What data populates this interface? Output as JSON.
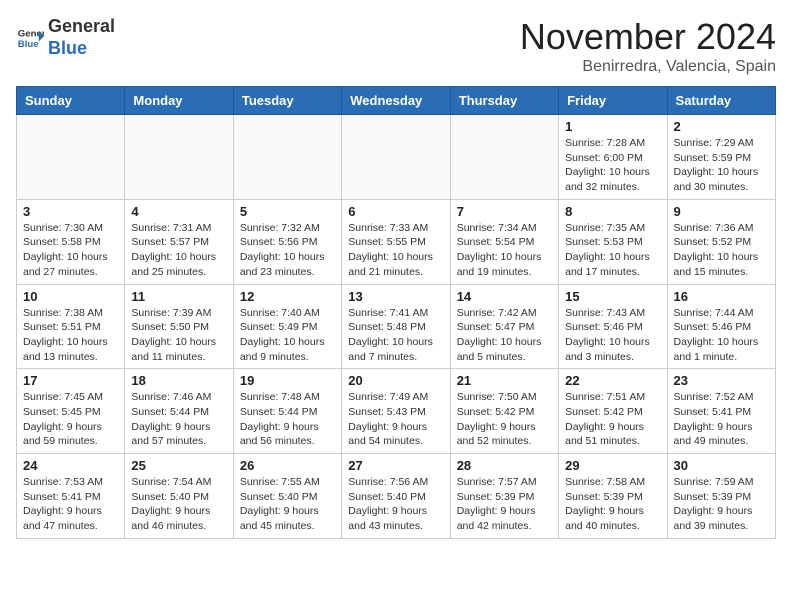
{
  "header": {
    "logo_general": "General",
    "logo_blue": "Blue",
    "month_year": "November 2024",
    "location": "Benirredra, Valencia, Spain"
  },
  "days_of_week": [
    "Sunday",
    "Monday",
    "Tuesday",
    "Wednesday",
    "Thursday",
    "Friday",
    "Saturday"
  ],
  "weeks": [
    [
      {
        "day": "",
        "info": ""
      },
      {
        "day": "",
        "info": ""
      },
      {
        "day": "",
        "info": ""
      },
      {
        "day": "",
        "info": ""
      },
      {
        "day": "",
        "info": ""
      },
      {
        "day": "1",
        "info": "Sunrise: 7:28 AM\nSunset: 6:00 PM\nDaylight: 10 hours\nand 32 minutes."
      },
      {
        "day": "2",
        "info": "Sunrise: 7:29 AM\nSunset: 5:59 PM\nDaylight: 10 hours\nand 30 minutes."
      }
    ],
    [
      {
        "day": "3",
        "info": "Sunrise: 7:30 AM\nSunset: 5:58 PM\nDaylight: 10 hours\nand 27 minutes."
      },
      {
        "day": "4",
        "info": "Sunrise: 7:31 AM\nSunset: 5:57 PM\nDaylight: 10 hours\nand 25 minutes."
      },
      {
        "day": "5",
        "info": "Sunrise: 7:32 AM\nSunset: 5:56 PM\nDaylight: 10 hours\nand 23 minutes."
      },
      {
        "day": "6",
        "info": "Sunrise: 7:33 AM\nSunset: 5:55 PM\nDaylight: 10 hours\nand 21 minutes."
      },
      {
        "day": "7",
        "info": "Sunrise: 7:34 AM\nSunset: 5:54 PM\nDaylight: 10 hours\nand 19 minutes."
      },
      {
        "day": "8",
        "info": "Sunrise: 7:35 AM\nSunset: 5:53 PM\nDaylight: 10 hours\nand 17 minutes."
      },
      {
        "day": "9",
        "info": "Sunrise: 7:36 AM\nSunset: 5:52 PM\nDaylight: 10 hours\nand 15 minutes."
      }
    ],
    [
      {
        "day": "10",
        "info": "Sunrise: 7:38 AM\nSunset: 5:51 PM\nDaylight: 10 hours\nand 13 minutes."
      },
      {
        "day": "11",
        "info": "Sunrise: 7:39 AM\nSunset: 5:50 PM\nDaylight: 10 hours\nand 11 minutes."
      },
      {
        "day": "12",
        "info": "Sunrise: 7:40 AM\nSunset: 5:49 PM\nDaylight: 10 hours\nand 9 minutes."
      },
      {
        "day": "13",
        "info": "Sunrise: 7:41 AM\nSunset: 5:48 PM\nDaylight: 10 hours\nand 7 minutes."
      },
      {
        "day": "14",
        "info": "Sunrise: 7:42 AM\nSunset: 5:47 PM\nDaylight: 10 hours\nand 5 minutes."
      },
      {
        "day": "15",
        "info": "Sunrise: 7:43 AM\nSunset: 5:46 PM\nDaylight: 10 hours\nand 3 minutes."
      },
      {
        "day": "16",
        "info": "Sunrise: 7:44 AM\nSunset: 5:46 PM\nDaylight: 10 hours\nand 1 minute."
      }
    ],
    [
      {
        "day": "17",
        "info": "Sunrise: 7:45 AM\nSunset: 5:45 PM\nDaylight: 9 hours\nand 59 minutes."
      },
      {
        "day": "18",
        "info": "Sunrise: 7:46 AM\nSunset: 5:44 PM\nDaylight: 9 hours\nand 57 minutes."
      },
      {
        "day": "19",
        "info": "Sunrise: 7:48 AM\nSunset: 5:44 PM\nDaylight: 9 hours\nand 56 minutes."
      },
      {
        "day": "20",
        "info": "Sunrise: 7:49 AM\nSunset: 5:43 PM\nDaylight: 9 hours\nand 54 minutes."
      },
      {
        "day": "21",
        "info": "Sunrise: 7:50 AM\nSunset: 5:42 PM\nDaylight: 9 hours\nand 52 minutes."
      },
      {
        "day": "22",
        "info": "Sunrise: 7:51 AM\nSunset: 5:42 PM\nDaylight: 9 hours\nand 51 minutes."
      },
      {
        "day": "23",
        "info": "Sunrise: 7:52 AM\nSunset: 5:41 PM\nDaylight: 9 hours\nand 49 minutes."
      }
    ],
    [
      {
        "day": "24",
        "info": "Sunrise: 7:53 AM\nSunset: 5:41 PM\nDaylight: 9 hours\nand 47 minutes."
      },
      {
        "day": "25",
        "info": "Sunrise: 7:54 AM\nSunset: 5:40 PM\nDaylight: 9 hours\nand 46 minutes."
      },
      {
        "day": "26",
        "info": "Sunrise: 7:55 AM\nSunset: 5:40 PM\nDaylight: 9 hours\nand 45 minutes."
      },
      {
        "day": "27",
        "info": "Sunrise: 7:56 AM\nSunset: 5:40 PM\nDaylight: 9 hours\nand 43 minutes."
      },
      {
        "day": "28",
        "info": "Sunrise: 7:57 AM\nSunset: 5:39 PM\nDaylight: 9 hours\nand 42 minutes."
      },
      {
        "day": "29",
        "info": "Sunrise: 7:58 AM\nSunset: 5:39 PM\nDaylight: 9 hours\nand 40 minutes."
      },
      {
        "day": "30",
        "info": "Sunrise: 7:59 AM\nSunset: 5:39 PM\nDaylight: 9 hours\nand 39 minutes."
      }
    ]
  ]
}
